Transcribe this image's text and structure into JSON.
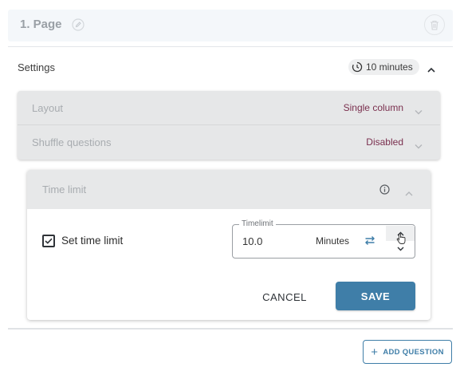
{
  "page_header": {
    "title": "1. Page"
  },
  "settings": {
    "label": "Settings",
    "time_chip": "10 minutes",
    "options": [
      {
        "label": "Layout",
        "value": "Single column"
      },
      {
        "label": "Shuffle questions",
        "value": "Disabled"
      }
    ]
  },
  "time_limit": {
    "title": "Time limit",
    "checkbox_label": "Set time limit",
    "checkbox_checked": true,
    "field": {
      "legend": "Timelimit",
      "value": "10.0",
      "unit": "Minutes"
    },
    "cancel_label": "CANCEL",
    "save_label": "SAVE"
  },
  "add_question_label": "ADD QUESTION",
  "colors": {
    "accent": "#3f7ea8",
    "value_text": "#7a2f4e",
    "panel_grey": "#e6e7e8"
  },
  "icons": [
    "edit-icon",
    "trash-icon",
    "timer-icon",
    "chevron-up-icon",
    "chevron-down-icon",
    "info-icon",
    "check-icon",
    "swap-icon",
    "cursor-icon",
    "plus-icon"
  ]
}
